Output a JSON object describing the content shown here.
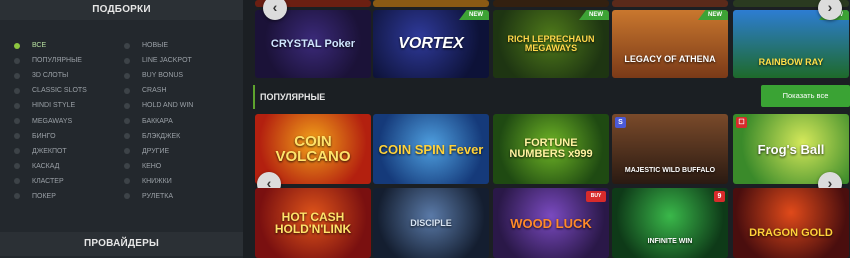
{
  "sidebar": {
    "title": "ПОДБОРКИ",
    "providers_title": "ПРОВАЙДЕРЫ",
    "left_items": [
      "ВСЕ",
      "ПОПУЛЯРНЫЕ",
      "3D СЛОТЫ",
      "CLASSIC SLOTS",
      "HINDI STYLE",
      "MEGAWAYS",
      "БИНГО",
      "ДЖЕКПОТ",
      "КАСКАД",
      "КЛАСТЕР",
      "ПОКЕР"
    ],
    "right_items": [
      "НОВЫЕ",
      "LINE JACKPOT",
      "BUY BONUS",
      "CRASH",
      "HOLD AND WIN",
      "БАККАРА",
      "БЛЭКДЖЕК",
      "ДРУГИЕ",
      "КЕНО",
      "КНИЖКИ",
      "РУЛЕТКА"
    ]
  },
  "new_games": {
    "badge": "NEW",
    "tiles": [
      "CRYSTAL Poker",
      "VORTEX",
      "RICH LEPRECHAUN MEGAWAYS",
      "LEGACY OF ATHENA",
      "RAINBOW RAY"
    ]
  },
  "popular": {
    "title": "ПОПУЛЯРНЫЕ",
    "show_all": "Показать все",
    "row1": [
      "COIN VOLCANO",
      "COIN SPIN Fever",
      "FORTUNE NUMBERS x999",
      "MAJESTIC WILD BUFFALO",
      "Frog's Ball"
    ],
    "row2": [
      "HOT CASH HOLD'N'LINK",
      "DISCIPLE",
      "WOOD LUCK",
      "INFINITE WIN",
      "DRAGON GOLD"
    ],
    "provider_badge_s": "S",
    "buy_badge": "BUY",
    "frogs_sub": "LOCK 2 SPIN",
    "wood_tag": "RISK Buy"
  },
  "colors": {
    "accent_green": "#3aa334",
    "active_dot": "#8dc63f"
  }
}
